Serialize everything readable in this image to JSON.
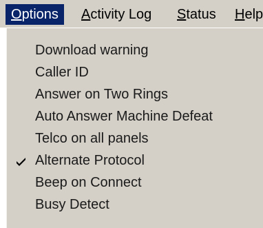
{
  "menubar": {
    "items": [
      {
        "accel": "O",
        "rest": "ptions"
      },
      {
        "accel": "A",
        "rest": "ctivity Log"
      },
      {
        "accel": "S",
        "rest": "tatus"
      },
      {
        "accel": "H",
        "rest": "elp"
      }
    ]
  },
  "options_menu": {
    "items": [
      {
        "label": "Download warning",
        "checked": false
      },
      {
        "label": "Caller ID",
        "checked": false
      },
      {
        "label": "Answer on Two Rings",
        "checked": false
      },
      {
        "label": "Auto Answer Machine Defeat",
        "checked": false
      },
      {
        "label": "Telco on all panels",
        "checked": false
      },
      {
        "label": "Alternate Protocol",
        "checked": true
      },
      {
        "label": "Beep on Connect",
        "checked": false
      },
      {
        "label": "Busy Detect",
        "checked": false
      }
    ],
    "check_icon": "checkmark-icon"
  },
  "colors": {
    "menu_background": "#d4d0c8",
    "highlight": "#0a246a",
    "highlight_text": "#ffffff",
    "text": "#000000"
  }
}
